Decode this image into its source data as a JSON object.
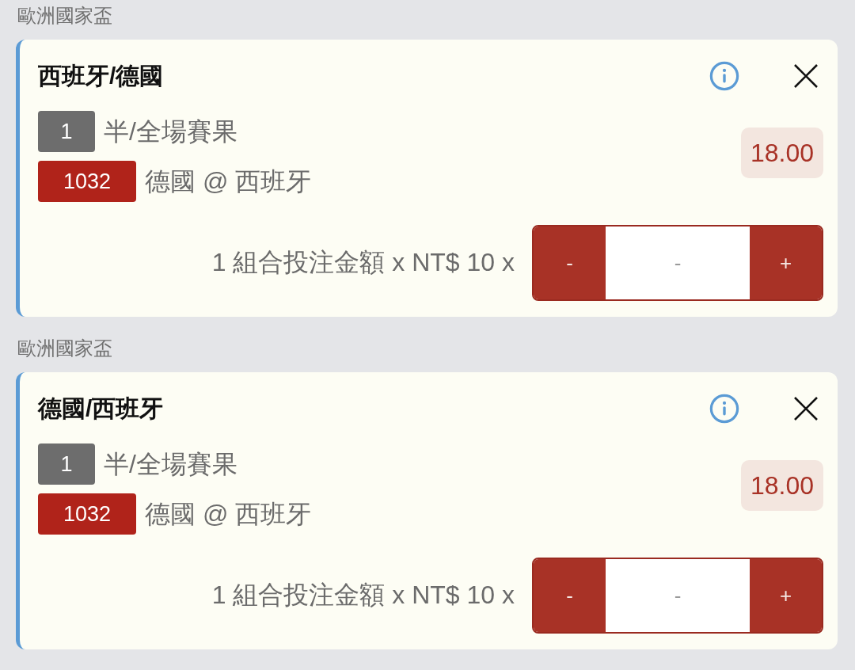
{
  "bets": [
    {
      "league": "歐洲國家盃",
      "title": "西班牙/德國",
      "market_no": "1",
      "market": "半/全場賽果",
      "selection_no": "1032",
      "selection": "德國 @ 西班牙",
      "odds": "18.00",
      "stake_text": "1 組合投注金額 x NT$ 10 x",
      "stepper": {
        "minus": "-",
        "placeholder": "-",
        "plus": "+"
      }
    },
    {
      "league": "歐洲國家盃",
      "title": "德國/西班牙",
      "market_no": "1",
      "market": "半/全場賽果",
      "selection_no": "1032",
      "selection": "德國 @ 西班牙",
      "odds": "18.00",
      "stake_text": "1 組合投注金額 x NT$ 10 x",
      "stepper": {
        "minus": "-",
        "placeholder": "-",
        "plus": "+"
      }
    }
  ]
}
